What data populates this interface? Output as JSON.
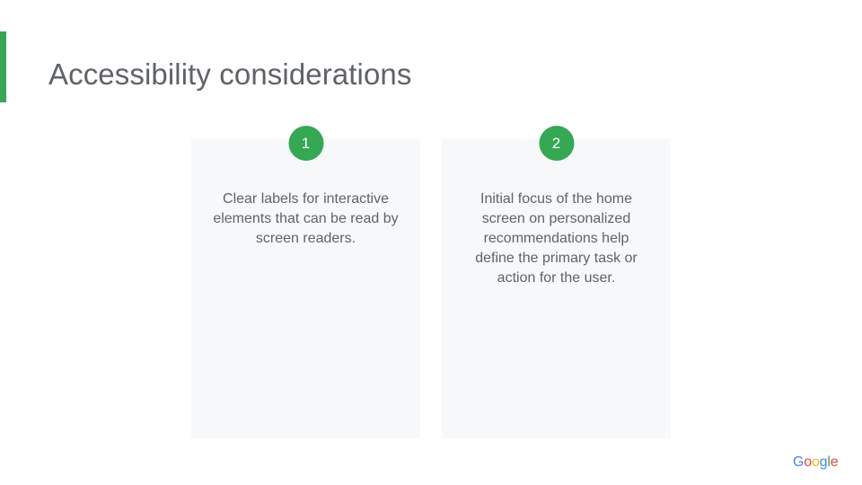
{
  "slide": {
    "title": "Accessibility considerations",
    "accent_color": "#34a853"
  },
  "cards": [
    {
      "number": "1",
      "text": "Clear labels for interactive elements that can be read by screen readers."
    },
    {
      "number": "2",
      "text": "Initial focus of the home screen on personalized recommendations help define the primary task or action for the user."
    }
  ],
  "footer": {
    "logo_text": "Google",
    "logo_letters": [
      {
        "char": "G",
        "color": "#4285f4"
      },
      {
        "char": "o",
        "color": "#ea4335"
      },
      {
        "char": "o",
        "color": "#fbbc05"
      },
      {
        "char": "g",
        "color": "#4285f4"
      },
      {
        "char": "l",
        "color": "#34a853"
      },
      {
        "char": "e",
        "color": "#ea4335"
      }
    ]
  }
}
